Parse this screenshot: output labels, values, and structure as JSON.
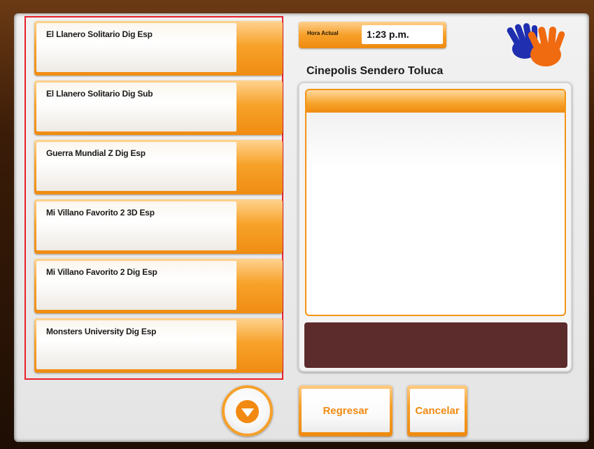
{
  "movies": [
    {
      "label": "El Llanero Solitario Dig Esp"
    },
    {
      "label": "El Llanero Solitario Dig Sub"
    },
    {
      "label": "Guerra Mundial Z Dig Esp"
    },
    {
      "label": "Mi Villano Favorito 2 3D Esp"
    },
    {
      "label": "Mi Villano Favorito 2 Dig Esp"
    },
    {
      "label": "Monsters University Dig Esp"
    }
  ],
  "clock": {
    "label": "Hora Actual",
    "value": "1:23 p.m."
  },
  "cinema": {
    "name": "Cinepolis Sendero Toluca"
  },
  "buttons": {
    "back": "Regresar",
    "cancel": "Cancelar"
  },
  "icons": {
    "logo": "hands-logo-icon",
    "scroll_down": "down-arrow-icon"
  },
  "colors": {
    "accent": "#f39415",
    "dark_panel": "#5c2b2b",
    "selection_border": "#e8202a"
  }
}
